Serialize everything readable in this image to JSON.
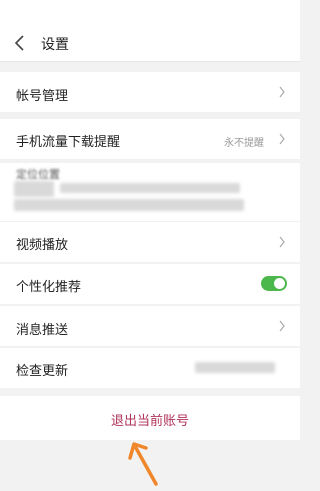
{
  "header": {
    "title": "设置"
  },
  "rows": {
    "account": {
      "label": "帐号管理"
    },
    "mobile_data": {
      "label": "手机流量下载提醒",
      "value": "永不提醒"
    },
    "location": {
      "label": "定位位置"
    },
    "video": {
      "label": "视频播放"
    },
    "personalized": {
      "label": "个性化推荐",
      "toggle_on": true
    },
    "notifications": {
      "label": "消息推送"
    },
    "update": {
      "label": "检查更新"
    }
  },
  "logout": {
    "label": "退出当前账号"
  },
  "colors": {
    "accent_logout": "#b0335a",
    "toggle_on": "#4cb84c",
    "arrow": "#f0872a"
  }
}
